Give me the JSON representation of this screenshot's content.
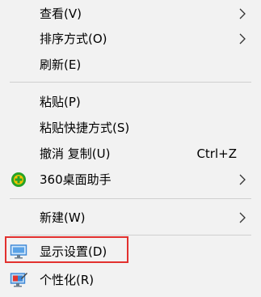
{
  "menu": {
    "items": [
      {
        "label": "查看(V)"
      },
      {
        "label": "排序方式(O)"
      },
      {
        "label": "刷新(E)"
      },
      {
        "label": "粘贴(P)"
      },
      {
        "label": "粘贴快捷方式(S)"
      },
      {
        "label": "撤消 复制(U)",
        "shortcut": "Ctrl+Z"
      },
      {
        "label": "360桌面助手"
      },
      {
        "label": "新建(W)"
      },
      {
        "label": "显示设置(D)"
      },
      {
        "label": "个性化(R)"
      }
    ]
  },
  "icons": {
    "assistant": "360-assistant-icon",
    "display": "display-monitor-icon",
    "personalize": "personalize-icon",
    "submenu": "chevron-right-icon"
  },
  "colors": {
    "menu_background": "#f2f2f2",
    "separator": "#cfcfcf",
    "highlight_box": "#e2312e",
    "assistant_green": "#27a327",
    "assistant_yellow": "#f5c400",
    "monitor_blue": "#3a86d6"
  }
}
